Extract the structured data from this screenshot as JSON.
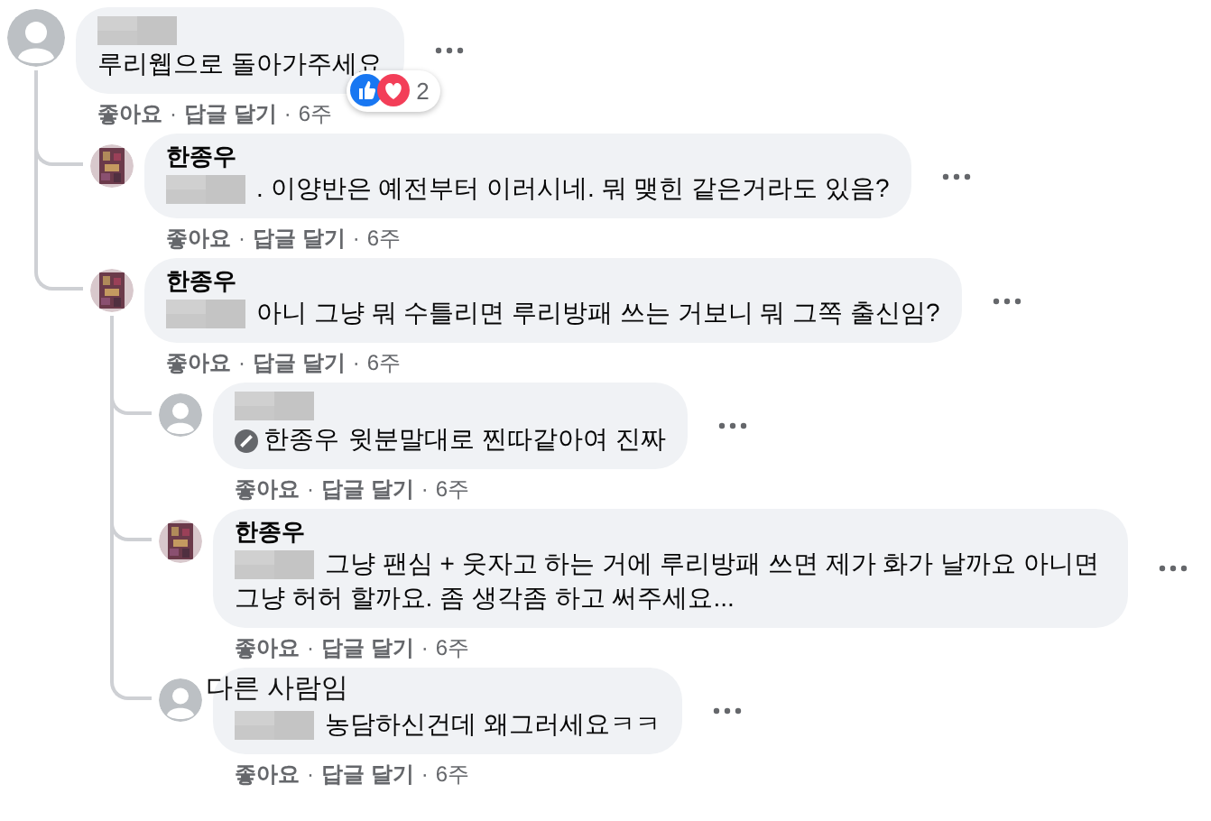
{
  "separator": "·",
  "comments": [
    {
      "avatar": {
        "kind": "default"
      },
      "author": {
        "kind": "redacted"
      },
      "text": "루리웹으로 돌아가주세요",
      "reactions": {
        "icons": [
          {
            "kind": "like"
          },
          {
            "kind": "love"
          }
        ],
        "count": "2"
      },
      "actions": [
        "좋아요",
        "답글 달기",
        "6주"
      ],
      "children": [
        {
          "author": {
            "kind": "name",
            "text": "한종우"
          },
          "prefix_redacted": true,
          "text": ". 이양반은 예전부터 이러시네. 뭐 맺힌 같은거라도 있음?",
          "actions": [
            "좋아요",
            "답글 달기",
            "6주"
          ]
        },
        {
          "author": {
            "kind": "name",
            "text": "한종우"
          },
          "prefix_redacted": true,
          "text": "아니 그냥 뭐 수틀리면 루리방패 쓰는 거보니 뭐 그쪽 출신임?",
          "actions": [
            "좋아요",
            "답글 달기",
            "6주"
          ],
          "children": [
            {
              "avatar": {
                "kind": "default"
              },
              "author": {
                "kind": "redacted"
              },
              "mention": "한종우",
              "text": "윗분말대로 찐따같아여 진짜",
              "actions": [
                "좋아요",
                "답글 달기",
                "6주"
              ]
            },
            {
              "author": {
                "kind": "name",
                "text": "한종우"
              },
              "prefix_redacted": true,
              "text": "그냥 팬심 + 웃자고 하는 거에 루리방패 쓰면 제가 화가 날까요 아니면 그냥 허허 할까요. 좀 생각좀 하고 써주세요...",
              "actions": [
                "좋아요",
                "답글 달기",
                "6주"
              ]
            },
            {
              "avatar": {
                "kind": "default"
              },
              "annotation": "다른 사람임",
              "prefix_redacted": true,
              "text": "농담하신건데 왜그러세요ㅋㅋ",
              "actions": [
                "좋아요",
                "답글 달기",
                "6주"
              ]
            }
          ]
        }
      ]
    }
  ]
}
